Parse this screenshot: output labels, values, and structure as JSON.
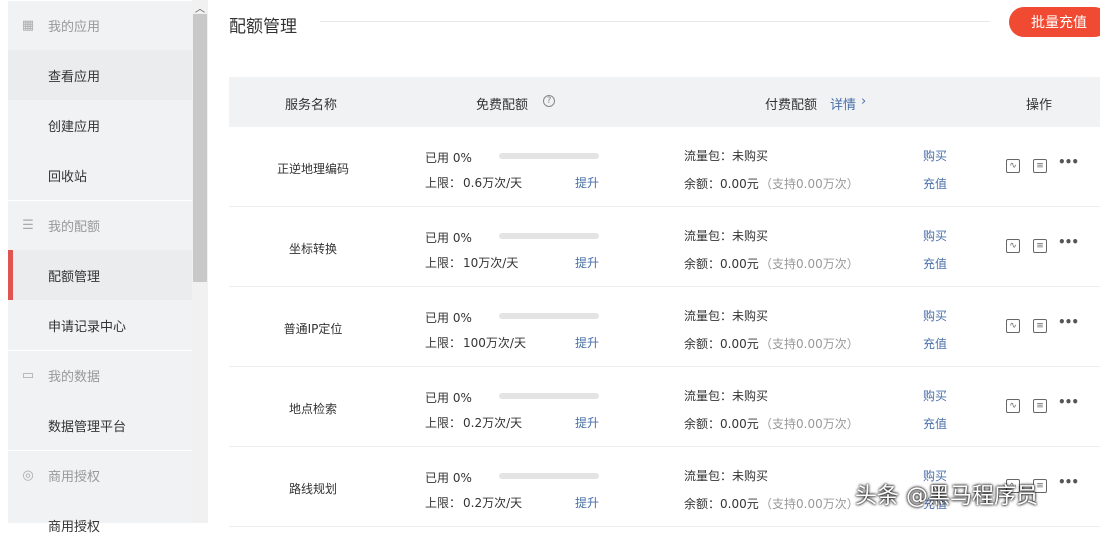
{
  "sidebar": {
    "groups": [
      {
        "label": "我的应用",
        "icon": "grid-icon",
        "items": [
          "查看应用",
          "创建应用",
          "回收站"
        ]
      },
      {
        "label": "我的配额",
        "icon": "sliders-icon",
        "items": [
          "配额管理",
          "申请记录中心"
        ]
      },
      {
        "label": "我的数据",
        "icon": "id-card-icon",
        "items": [
          "数据管理平台"
        ]
      },
      {
        "label": "商用授权",
        "icon": "badge-icon",
        "items": [
          "商用授权"
        ]
      }
    ],
    "active": "配额管理"
  },
  "page": {
    "title": "配额管理",
    "batch_button": "批量充值"
  },
  "table": {
    "headers": {
      "name": "服务名称",
      "free": "免费配额",
      "paid": "付费配额",
      "detail": "详情",
      "ops": "操作"
    },
    "rows": [
      {
        "name": "正逆地理编码",
        "used": "已用 0%",
        "limit_label": "上限：",
        "limit": "0.6万次/天",
        "upgrade": "提升",
        "pack": "流量包：未购买",
        "balance": "余额：0.00元",
        "support": "（支持0.00万次）",
        "buy": "购买",
        "recharge": "充值",
        "used_fraction": 0
      },
      {
        "name": "坐标转换",
        "used": "已用 0%",
        "limit_label": "上限：",
        "limit": "10万次/天",
        "upgrade": "提升",
        "pack": "流量包：未购买",
        "balance": "余额：0.00元",
        "support": "（支持0.00万次）",
        "buy": "购买",
        "recharge": "充值",
        "used_fraction": 0
      },
      {
        "name": "普通IP定位",
        "used": "已用 0%",
        "limit_label": "上限：",
        "limit": "100万次/天",
        "upgrade": "提升",
        "pack": "流量包：未购买",
        "balance": "余额：0.00元",
        "support": "（支持0.00万次）",
        "buy": "购买",
        "recharge": "充值",
        "used_fraction": 0
      },
      {
        "name": "地点检索",
        "used": "已用 0%",
        "limit_label": "上限：",
        "limit": "0.2万次/天",
        "upgrade": "提升",
        "pack": "流量包：未购买",
        "balance": "余额：0.00元",
        "support": "（支持0.00万次）",
        "buy": "购买",
        "recharge": "充值",
        "used_fraction": 0
      },
      {
        "name": "路线规划",
        "used": "已用 0%",
        "limit_label": "上限：",
        "limit": "0.2万次/天",
        "upgrade": "提升",
        "pack": "流量包：未购买",
        "balance": "余额：0.00元",
        "support": "（支持0.00万次）",
        "buy": "购买",
        "recharge": "充值",
        "used_fraction": 0
      }
    ]
  },
  "watermark": "头条 @黑马程序员"
}
